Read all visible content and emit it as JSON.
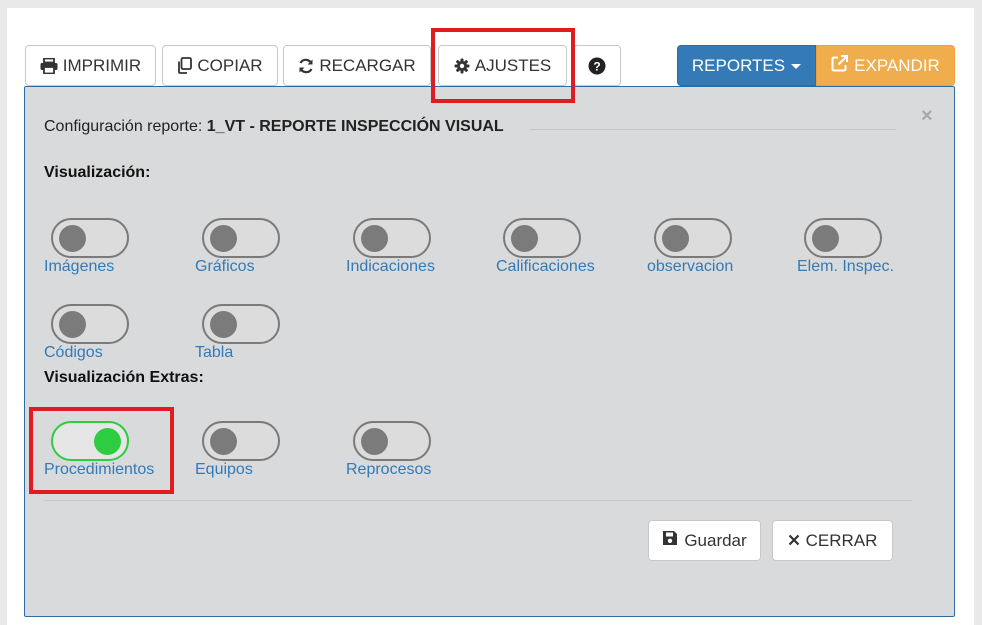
{
  "toolbar": {
    "imprimir": "IMPRIMIR",
    "copiar": "COPIAR",
    "recargar": "RECARGAR",
    "ajustes": "AJUSTES",
    "reportes": "REPORTES",
    "expandir": "EXPANDIR"
  },
  "panel": {
    "title_prefix": "Configuración reporte:",
    "title_value": "1_VT - REPORTE INSPECCIÓN VISUAL",
    "close": "×",
    "section_visualizacion": "Visualización:",
    "section_extras": "Visualización Extras:",
    "toggles": [
      {
        "label": "Imágenes",
        "on": false
      },
      {
        "label": "Gráficos",
        "on": false
      },
      {
        "label": "Indicaciones",
        "on": false
      },
      {
        "label": "Calificaciones",
        "on": false
      },
      {
        "label": "observacion",
        "on": false
      },
      {
        "label": "Elem. Inspec.",
        "on": false
      },
      {
        "label": "Códigos",
        "on": false
      },
      {
        "label": "Tabla",
        "on": false
      }
    ],
    "extras": [
      {
        "label": "Procedimientos",
        "on": true
      },
      {
        "label": "Equipos",
        "on": false
      },
      {
        "label": "Reprocesos",
        "on": false
      }
    ],
    "guardar": "Guardar",
    "cerrar": "CERRAR"
  },
  "colors": {
    "primary": "#337ab7",
    "warning": "#f0ad4e",
    "toggle_on": "#2ecc40",
    "highlight": "#e11b22",
    "panel_bg": "#d9dadb"
  }
}
